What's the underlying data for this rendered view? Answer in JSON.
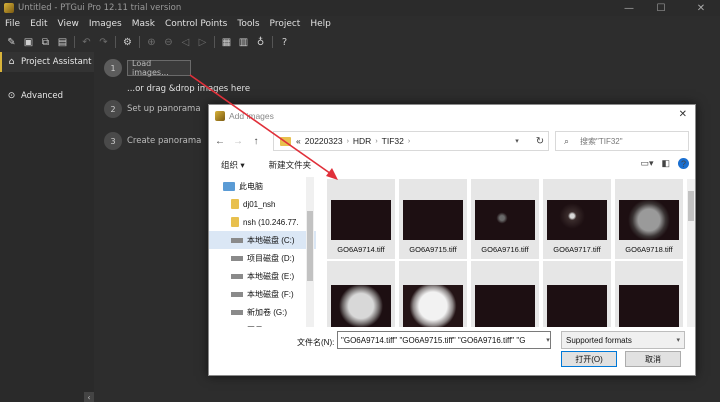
{
  "window": {
    "title": "Untitled - PTGui Pro 12.11 trial version",
    "controls": [
      "—",
      "☐",
      "✕"
    ]
  },
  "menu": [
    "File",
    "Edit",
    "View",
    "Images",
    "Mask",
    "Control Points",
    "Tools",
    "Project",
    "Help"
  ],
  "toolbar": {
    "icons": [
      "new-icon",
      "edit-icon",
      "copy-icon",
      "save-icon",
      "undo-icon",
      "redo-icon",
      "gear-icon",
      "zoom-in-icon",
      "zoom-out-icon",
      "rewind-icon",
      "forward-icon",
      "panorama-editor-icon",
      "grid-icon",
      "bulb-icon",
      "help-icon"
    ]
  },
  "sidebar": {
    "items": [
      {
        "label": "Project Assistant",
        "icon": "home-icon",
        "active": true
      },
      {
        "label": "Advanced",
        "icon": "chevron-circle-icon",
        "active": false
      }
    ],
    "collapse_glyph": "‹"
  },
  "assistant": {
    "steps": [
      {
        "num": "1",
        "label": "Load images..."
      },
      {
        "num": "2",
        "label": "Set up panorama"
      },
      {
        "num": "3",
        "label": "Create panorama"
      }
    ],
    "drag_text": "...or drag &drop images here"
  },
  "dialog": {
    "title": "Add images",
    "close": "✕",
    "nav": {
      "back": "←",
      "forward": "→",
      "up": "↑"
    },
    "address": {
      "prefix": "«",
      "segments": [
        "20220323",
        "HDR",
        "TIF32"
      ],
      "separator": "›"
    },
    "search_placeholder": "搜索\"TIF32\"",
    "commands": {
      "organize": "组织 ▾",
      "new_folder": "新建文件夹"
    },
    "tree": [
      {
        "label": "此电脑",
        "icon": "pc",
        "indent": 14,
        "selected": false
      },
      {
        "label": "dj01_nsh",
        "icon": "folder",
        "indent": 22,
        "selected": false
      },
      {
        "label": "nsh (10.246.77.",
        "icon": "folder",
        "indent": 22,
        "selected": false
      },
      {
        "label": "本地磁盘 (C:)",
        "icon": "drive",
        "indent": 22,
        "selected": true
      },
      {
        "label": "项目磁盘 (D:)",
        "icon": "drive",
        "indent": 22,
        "selected": false
      },
      {
        "label": "本地磁盘 (E:)",
        "icon": "drive",
        "indent": 22,
        "selected": false
      },
      {
        "label": "本地磁盘 (F:)",
        "icon": "drive",
        "indent": 22,
        "selected": false
      },
      {
        "label": "新加卷 (G:)",
        "icon": "drive",
        "indent": 22,
        "selected": false
      },
      {
        "label": "网易 (M:)",
        "icon": "net",
        "indent": 22,
        "selected": false
      }
    ],
    "files": [
      {
        "name": "GO6A9714.tiff",
        "thumb": "dark"
      },
      {
        "name": "GO6A9715.tiff",
        "thumb": "dark"
      },
      {
        "name": "GO6A9716.tiff",
        "thumb": "light-dim"
      },
      {
        "name": "GO6A9717.tiff",
        "thumb": "light"
      },
      {
        "name": "GO6A9718.tiff",
        "thumb": "sphere"
      },
      {
        "name": "",
        "thumb": "sphere-bright"
      },
      {
        "name": "",
        "thumb": "sphere-brighter"
      },
      {
        "name": "",
        "thumb": "dark"
      },
      {
        "name": "",
        "thumb": "dark"
      },
      {
        "name": "",
        "thumb": "dark"
      }
    ],
    "filename_label": "文件名(N):",
    "filename_value": "\"GO6A9714.tiff\" \"GO6A9715.tiff\" \"GO6A9716.tiff\" \"G",
    "format_value": "Supported formats",
    "open_button": "打开(O)",
    "cancel_button": "取消"
  },
  "colors": {
    "accent": "#d8b33a",
    "arrow": "#e0303a",
    "selection": "#dbe7f5",
    "thumb_bg": "#1d0f12"
  }
}
